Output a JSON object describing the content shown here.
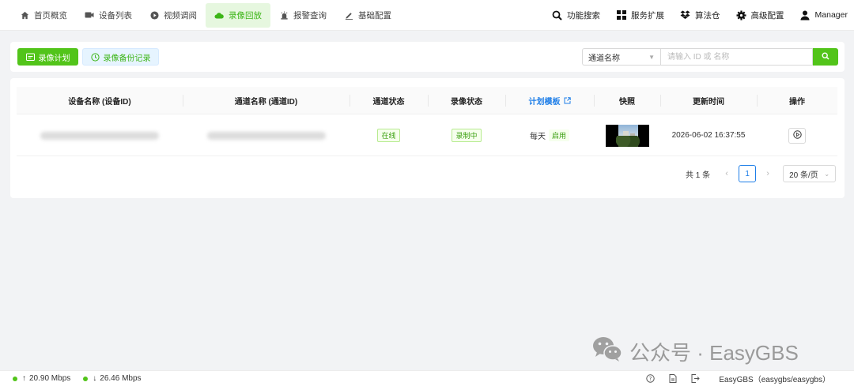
{
  "nav": {
    "items": [
      {
        "label": "首页概览",
        "icon": "home-icon"
      },
      {
        "label": "设备列表",
        "icon": "camera-icon"
      },
      {
        "label": "视频调阅",
        "icon": "play-circle-icon"
      },
      {
        "label": "录像回放",
        "icon": "cloud-icon",
        "active": true
      },
      {
        "label": "报警查询",
        "icon": "alarm-icon"
      },
      {
        "label": "基础配置",
        "icon": "edit-icon"
      }
    ],
    "tools": [
      {
        "label": "功能搜索",
        "icon": "search-icon"
      },
      {
        "label": "服务扩展",
        "icon": "grid-icon"
      },
      {
        "label": "算法仓",
        "icon": "dropbox-icon"
      },
      {
        "label": "高级配置",
        "icon": "gear-icon"
      },
      {
        "label": "Manager",
        "icon": "user-icon"
      }
    ]
  },
  "toolbar": {
    "plan_label": "录像计划",
    "backup_label": "录像备份记录",
    "select_value": "通道名称",
    "search_placeholder": "请输入 ID 或 名称"
  },
  "table": {
    "headers": [
      "设备名称 (设备ID)",
      "通道名称 (通道ID)",
      "通道状态",
      "录像状态",
      "计划模板",
      "快照",
      "更新时间",
      "操作"
    ],
    "rows": [
      {
        "channel_status": "在线",
        "record_status": "录制中",
        "plan": "每天",
        "plan_tag": "启用",
        "updated": "2026-06-02 16:37:55"
      }
    ]
  },
  "pager": {
    "total": "共 1 条",
    "current": "1",
    "page_size": "20 条/页"
  },
  "watermark": {
    "text": "公众号 · EasyGBS"
  },
  "status": {
    "upload": "20.90 Mbps",
    "download": "26.46 Mbps",
    "account": "EasyGBS（easygbs/easygbs）"
  },
  "colors": {
    "primary": "#52c41a",
    "link": "#1e7ee8",
    "active_bg": "#e6f7df"
  }
}
